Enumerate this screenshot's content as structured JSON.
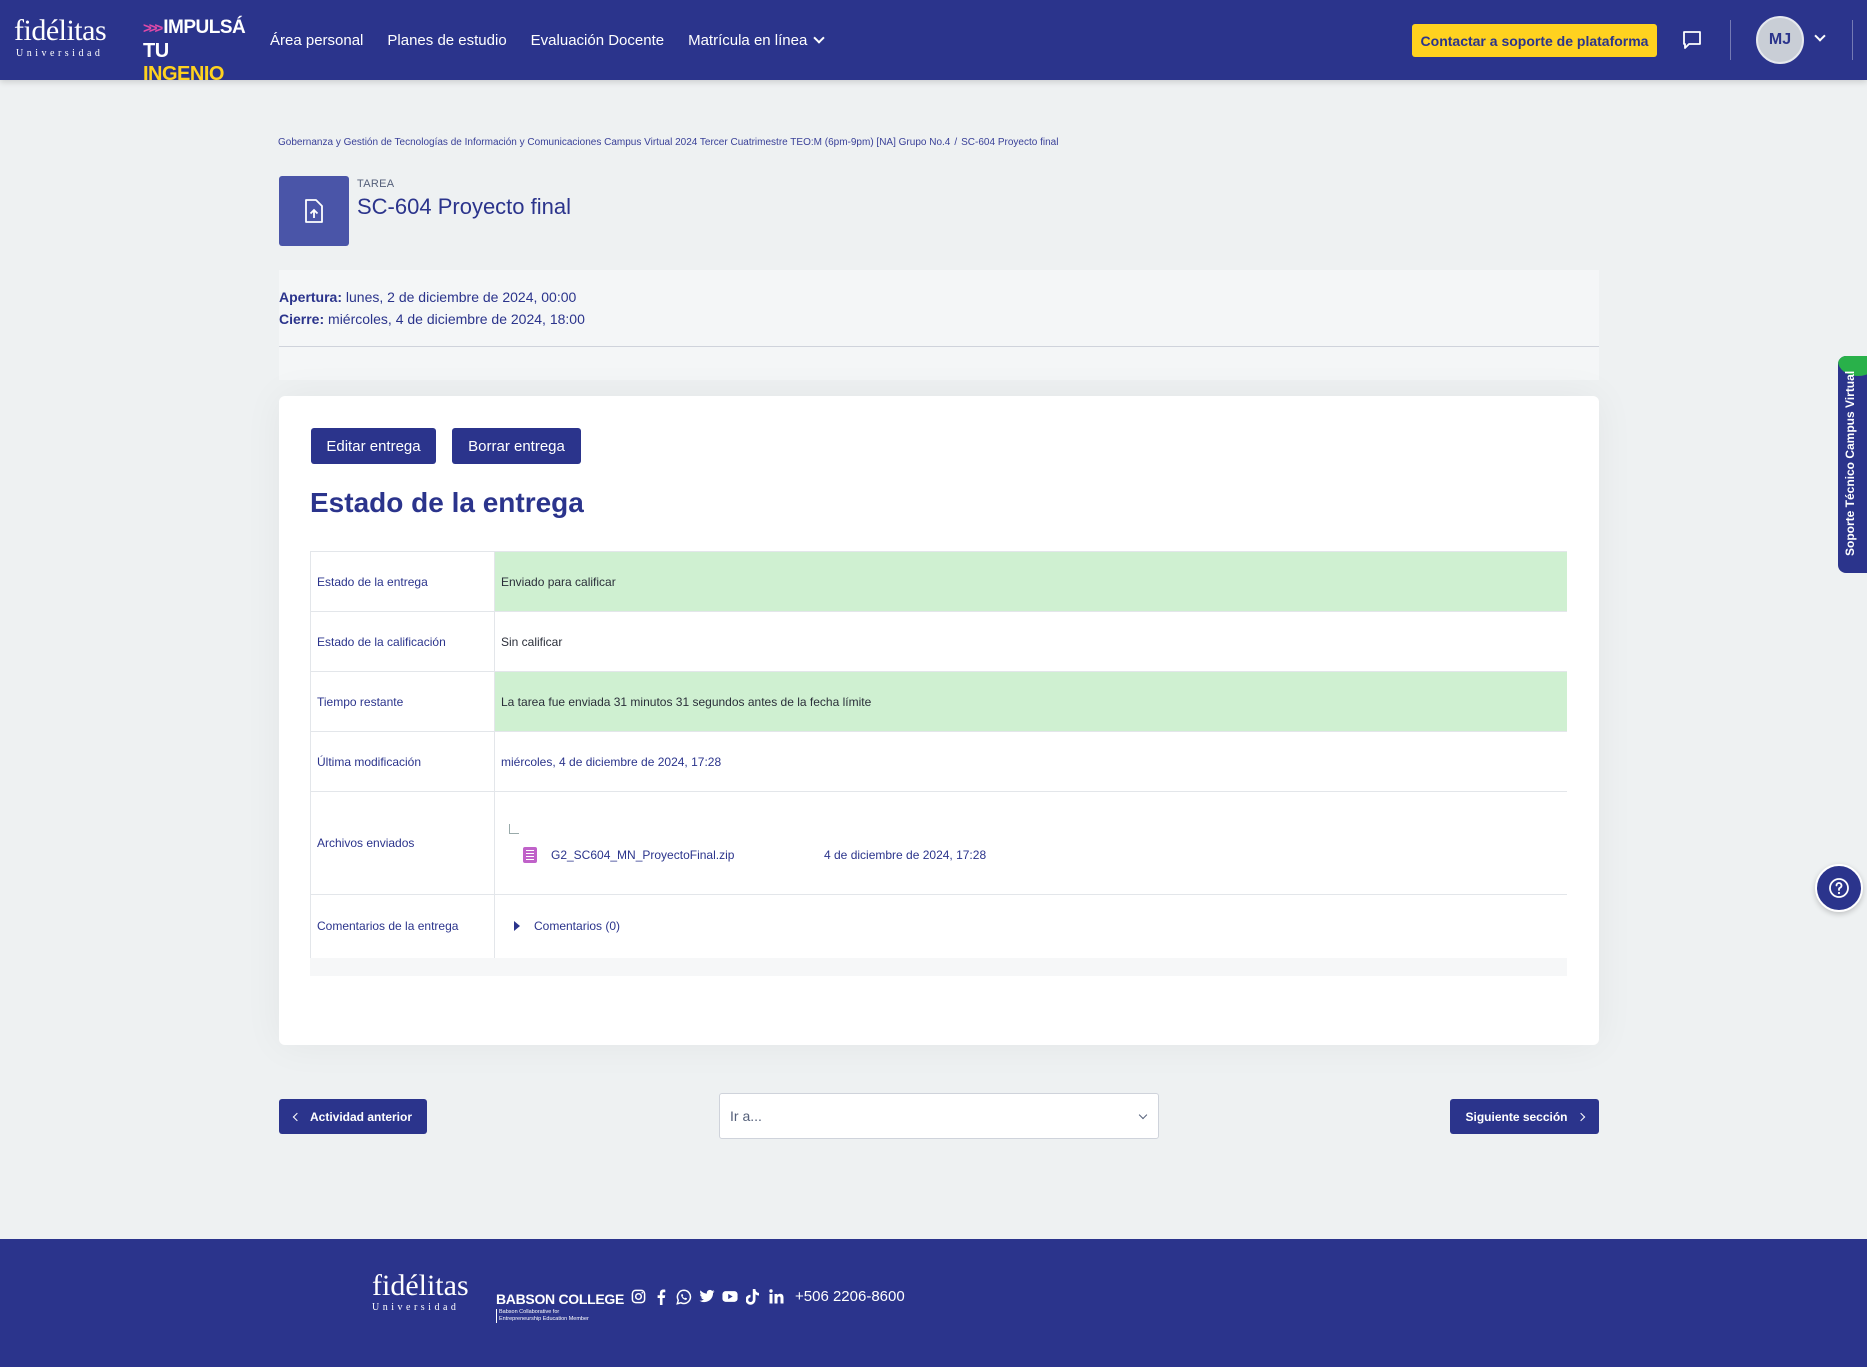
{
  "navbar": {
    "logo_text": "fidélitas",
    "logo_sub": "Universidad",
    "slogan_line1": "IMPULSÁ",
    "slogan_line2_a": "TU",
    "slogan_line2_b": "INGENIO",
    "links": [
      "Área personal",
      "Planes de estudio",
      "Evaluación Docente",
      "Matrícula en línea"
    ],
    "support_button": "Contactar a soporte de plataforma",
    "avatar_initials": "MJ",
    "brand_color": "#2b348c",
    "accent_color": "#ffd21f"
  },
  "breadcrumb": {
    "course": "Gobernanza y Gestión de Tecnologías de Información y Comunicaciones Campus Virtual 2024 Tercer Cuatrimestre TEO:M (6pm-9pm) [NA] Grupo No.4",
    "separator": "/",
    "current": "SC-604 Proyecto final"
  },
  "activity": {
    "type": "TAREA",
    "title": "SC-604 Proyecto final",
    "icon": "file-upload-icon"
  },
  "dates": {
    "open_label": "Apertura:",
    "open_value": "lunes, 2 de diciembre de 2024, 00:00",
    "close_label": "Cierre:",
    "close_value": "miércoles, 4 de diciembre de 2024, 18:00"
  },
  "actions": {
    "edit": "Editar entrega",
    "delete": "Borrar entrega"
  },
  "submission": {
    "heading": "Estado de la entrega",
    "rows": [
      {
        "label": "Estado de la entrega",
        "value": "Enviado para calificar"
      },
      {
        "label": "Estado de la calificación",
        "value": "Sin calificar"
      },
      {
        "label": "Tiempo restante",
        "value": "La tarea fue enviada 31 minutos 31 segundos antes de la fecha límite"
      },
      {
        "label": "Última modificación",
        "value": "miércoles, 4 de diciembre de 2024, 17:28"
      },
      {
        "label": "Archivos enviados",
        "file_name": "G2_SC604_MN_ProyectoFinal.zip",
        "file_date": "4 de diciembre de 2024, 17:28"
      },
      {
        "label": "Comentarios de la entrega",
        "value": "Comentarios (0)"
      }
    ],
    "success_color": "#cff0d1"
  },
  "bottom_nav": {
    "prev": "Actividad anterior",
    "jump_placeholder": "Ir a...",
    "next": "Siguiente sección"
  },
  "side_tab": "Soporte Técnico Campus Virtual",
  "footer": {
    "logo_text": "fidélitas",
    "logo_sub": "Universidad",
    "partner": "BABSON COLLEGE",
    "partner_sub1": "Babson Collaborative for",
    "partner_sub2": "Entrepreneurship Education Member",
    "social_icons": [
      "instagram-icon",
      "facebook-icon",
      "whatsapp-icon",
      "twitter-icon",
      "youtube-icon",
      "tiktok-icon",
      "linkedin-icon"
    ],
    "phone": "+506 2206-8600"
  }
}
